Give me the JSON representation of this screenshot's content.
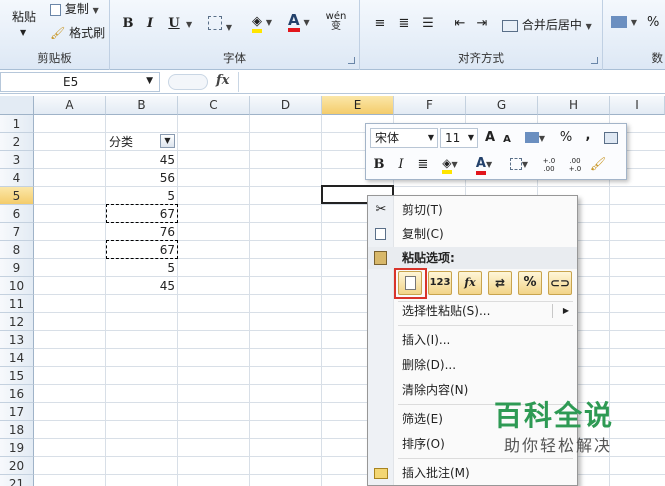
{
  "ribbon": {
    "clipboard": {
      "paste": "粘贴",
      "copy": "复制",
      "format_painter": "格式刷",
      "group_label": "剪贴板"
    },
    "font": {
      "bold": "B",
      "italic": "I",
      "underline": "U",
      "font_color_glyph": "A",
      "phonetic": "wén 变",
      "group_label": "字体"
    },
    "alignment": {
      "merge_center": "合并后居中",
      "group_label": "对齐方式"
    },
    "number": {
      "percent": "%",
      "group_label": "数"
    }
  },
  "formula_bar": {
    "name_box": "E5",
    "fx": "fx",
    "value": ""
  },
  "columns": [
    "A",
    "B",
    "C",
    "D",
    "E",
    "F",
    "G",
    "H",
    "I"
  ],
  "rows": [
    "1",
    "2",
    "3",
    "4",
    "5",
    "6",
    "7",
    "8",
    "9",
    "10",
    "11",
    "12",
    "13",
    "14",
    "15",
    "16",
    "17",
    "18",
    "19",
    "20",
    "21"
  ],
  "cells": {
    "b2": "分类",
    "b3": "45",
    "b4": "56",
    "b5": "5",
    "b6": "67",
    "b7": "76",
    "b8": "67",
    "b9": "5",
    "b10": "45"
  },
  "mini_toolbar": {
    "font_name": "宋体",
    "font_size": "11",
    "grow": "A",
    "shrink": "A",
    "percent": "%",
    "comma": ",",
    "bold": "B",
    "italic": "I",
    "font_color": "A",
    "inc_decimal": "+.0 .00",
    "dec_decimal": ".00 +.0"
  },
  "context_menu": {
    "cut": "剪切(T)",
    "copy": "复制(C)",
    "paste_options": "粘贴选项:",
    "paste_value_glyph": "123",
    "paste_formula_glyph": "fx",
    "paste_percent_glyph": "%",
    "paste_special": "选择性粘贴(S)...",
    "insert": "插入(I)...",
    "delete": "删除(D)...",
    "clear": "清除内容(N)",
    "filter": "筛选(E)",
    "sort": "排序(O)",
    "insert_comment": "插入批注(M)"
  },
  "watermark": {
    "title": "百科全说",
    "subtitle": "助你轻松解决"
  },
  "colors": {
    "accent": "#2e9a54",
    "selection_header": "#f4cc6b",
    "highlight": "#d9342b"
  }
}
